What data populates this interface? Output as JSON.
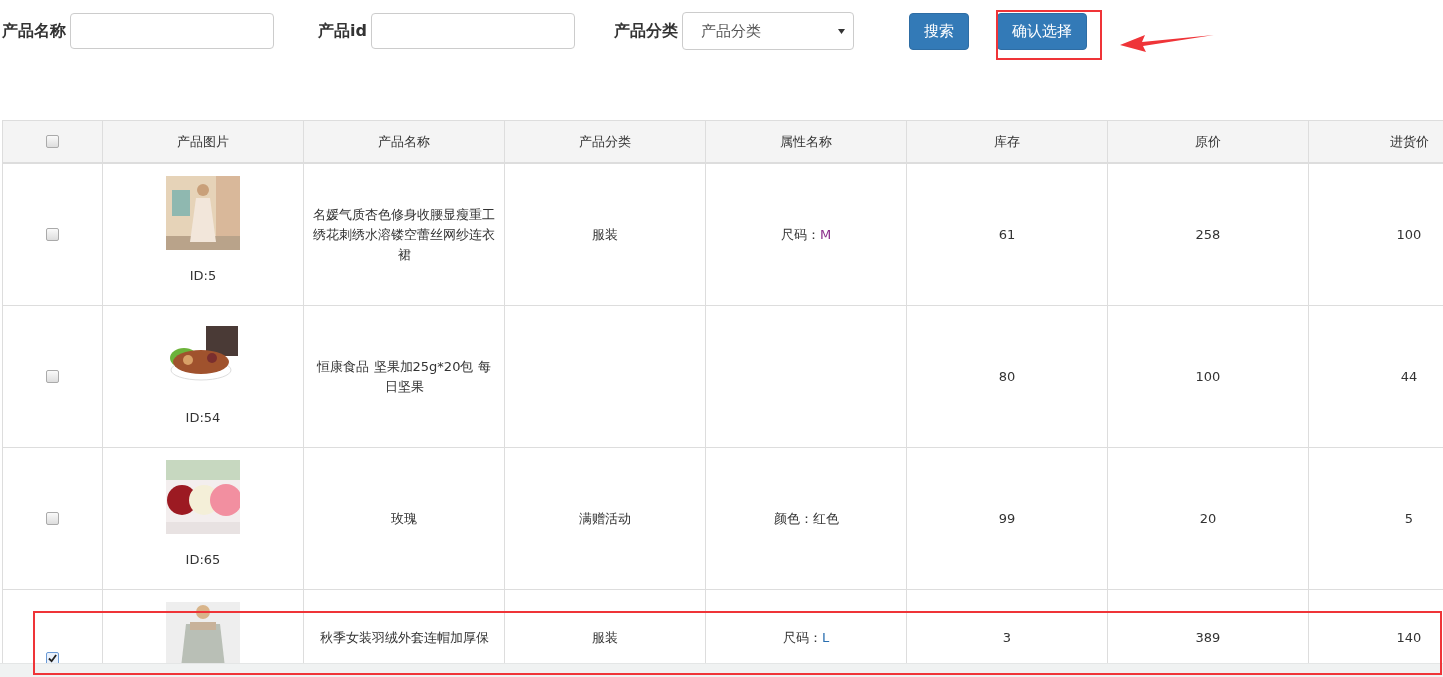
{
  "filters": [
    {
      "kind": "input",
      "label": "产品名称"
    },
    {
      "kind": "input",
      "label": "产品id"
    },
    {
      "kind": "select",
      "label": "产品分类",
      "value": "产品分类"
    }
  ],
  "buttons": [
    {
      "label": "搜索"
    },
    {
      "label": "确认选择"
    }
  ],
  "table": {
    "header_checked": false,
    "columns": [
      "产品图片",
      "产品名称",
      "产品分类",
      "属性名称",
      "库存",
      "原价",
      "进货价"
    ],
    "rows": [
      {
        "checked": false,
        "id": "ID:5",
        "name": "名媛气质杏色修身收腰显瘦重工绣花刺绣水溶镂空蕾丝网纱连衣裙",
        "category": "服装",
        "attribute": {
          "label": "尺码：",
          "value": "M",
          "color": "#8b2f8b"
        },
        "stock": "61",
        "price": "258",
        "cost": "100"
      },
      {
        "checked": false,
        "id": "ID:54",
        "name": "恒康食品 坚果加25g*20包 每日坚果",
        "stock": "80",
        "price": "100",
        "cost": "44"
      },
      {
        "checked": false,
        "id": "ID:65",
        "name": "玫瑰",
        "category": "满赠活动",
        "attribute": {
          "label": "颜色：",
          "value": "红色",
          "color": "#333333"
        },
        "stock": "99",
        "price": "20",
        "cost": "5"
      },
      {
        "checked": true,
        "name": "秋季女装羽绒外套连帽加厚保",
        "category": "服装",
        "attribute": {
          "label": "尺码：",
          "value": "L",
          "color": "#2a6fb0"
        },
        "stock": "3",
        "price": "389",
        "cost": "140"
      }
    ]
  }
}
